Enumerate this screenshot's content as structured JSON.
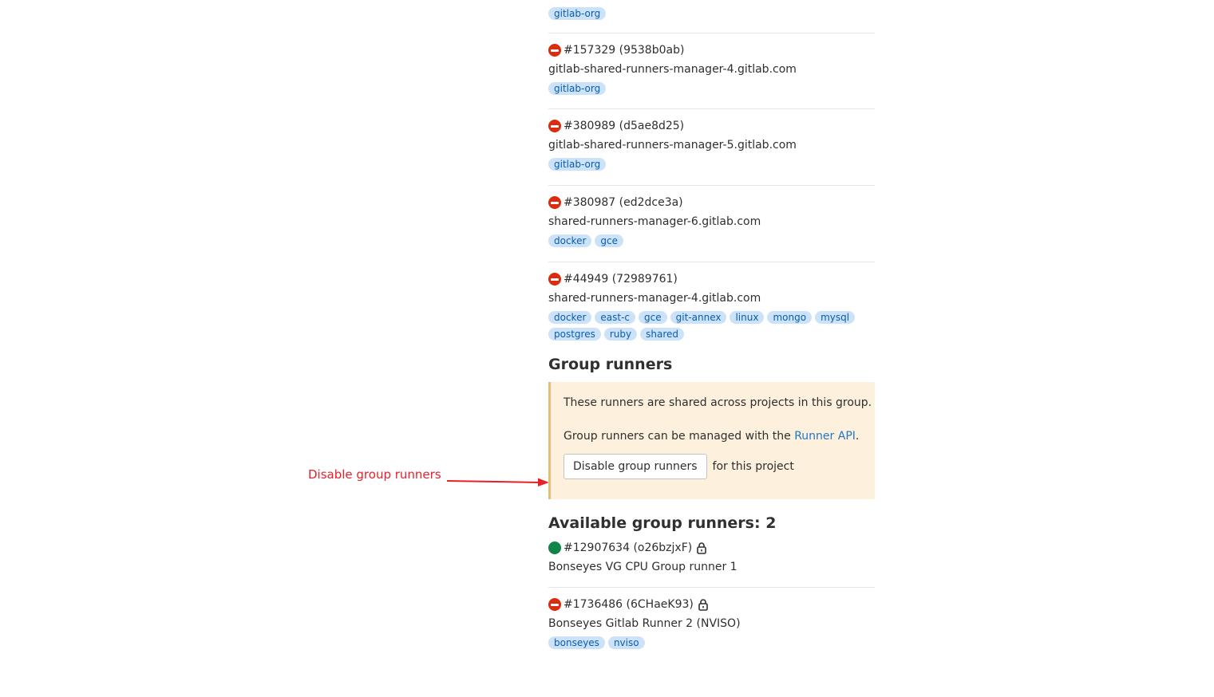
{
  "shared_runners": [
    {
      "partial": true,
      "tags": [
        "gitlab-org"
      ]
    },
    {
      "id_label": "#157329 (9538b0ab)",
      "description": "gitlab-shared-runners-manager-4.gitlab.com",
      "status": "paused",
      "tags": [
        "gitlab-org"
      ]
    },
    {
      "id_label": "#380989 (d5ae8d25)",
      "description": "gitlab-shared-runners-manager-5.gitlab.com",
      "status": "paused",
      "tags": [
        "gitlab-org"
      ]
    },
    {
      "id_label": "#380987 (ed2dce3a)",
      "description": "shared-runners-manager-6.gitlab.com",
      "status": "paused",
      "tags": [
        "docker",
        "gce"
      ]
    },
    {
      "id_label": "#44949 (72989761)",
      "description": "shared-runners-manager-4.gitlab.com",
      "status": "paused",
      "tags": [
        "docker",
        "east-c",
        "gce",
        "git-annex",
        "linux",
        "mongo",
        "mysql",
        "postgres",
        "ruby",
        "shared"
      ]
    }
  ],
  "group_runners": {
    "heading": "Group runners",
    "info_line1": "These runners are shared across projects in this group.",
    "info_line2_prefix": "Group runners can be managed with the ",
    "info_line2_link": "Runner API",
    "info_line2_suffix": ".",
    "disable_button_label": "Disable group runners",
    "disable_suffix": "for this project"
  },
  "available_group_runners": {
    "heading": "Available group runners: 2",
    "runners": [
      {
        "id_label": "#12907634 (o26bzjxF)",
        "description": "Bonseyes VG CPU Group runner 1",
        "status": "online",
        "locked": true,
        "tags": []
      },
      {
        "id_label": "#1736486 (6CHaeK93)",
        "description": "Bonseyes Gitlab Runner 2 (NVISO)",
        "status": "paused",
        "locked": true,
        "tags": [
          "bonseyes",
          "nviso"
        ]
      }
    ]
  },
  "annotation": {
    "text": "Disable group runners",
    "color": "#e8202a"
  },
  "colors": {
    "status_paused": "#dd2b0e",
    "status_online": "#108548",
    "tag_bg": "#cbe2f9",
    "tag_text": "#0b5cad",
    "info_bg": "#fdf1dd",
    "info_border": "#e9be74",
    "link": "#1f75cb"
  }
}
